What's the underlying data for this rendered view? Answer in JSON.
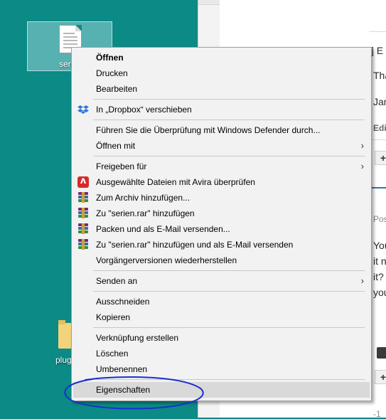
{
  "desktop": {
    "icons": [
      {
        "label": "seri",
        "kind": "document",
        "selected": true
      },
      {
        "label": "plug",
        "kind": "folder",
        "selected": false
      }
    ],
    "background_color": "#0b8a86"
  },
  "browser": {
    "fragments": [
      "] E",
      "Tha",
      "Jan",
      "Edi",
      "+",
      "Pos",
      "You",
      "it n",
      "it?",
      "you",
      "+",
      "-1"
    ],
    "accent_color": "#3a6fb0"
  },
  "context_menu": {
    "items": [
      {
        "label": "Öffnen",
        "bold": true
      },
      {
        "label": "Drucken"
      },
      {
        "label": "Bearbeiten"
      },
      {
        "label": "In „Dropbox“ verschieben",
        "icon": "dropbox-icon"
      },
      {
        "label": "Führen Sie die Überprüfung mit Windows Defender durch..."
      },
      {
        "label": "Öffnen mit",
        "submenu": true
      },
      {
        "label": "Freigeben für",
        "submenu": true
      },
      {
        "label": "Ausgewählte Dateien mit Avira überprüfen",
        "icon": "avira-icon"
      },
      {
        "label": "Zum Archiv hinzufügen...",
        "icon": "winrar-icon"
      },
      {
        "label": "Zu \"serien.rar\" hinzufügen",
        "icon": "winrar-icon"
      },
      {
        "label": "Packen und als E-Mail versenden...",
        "icon": "winrar-icon"
      },
      {
        "label": "Zu \"serien.rar\" hinzufügen und als E-Mail versenden",
        "icon": "winrar-icon"
      },
      {
        "label": "Vorgängerversionen wiederherstellen"
      },
      {
        "label": "Senden an",
        "submenu": true
      },
      {
        "label": "Ausschneiden"
      },
      {
        "label": "Kopieren"
      },
      {
        "label": "Verknüpfung erstellen"
      },
      {
        "label": "Löschen"
      },
      {
        "label": "Umbenennen"
      },
      {
        "label": "Eigenschaften",
        "highlighted": true
      }
    ],
    "submenu_arrow": "›",
    "highlight_color": "#d9d9d9",
    "annotation_color": "#1b2fd0"
  }
}
